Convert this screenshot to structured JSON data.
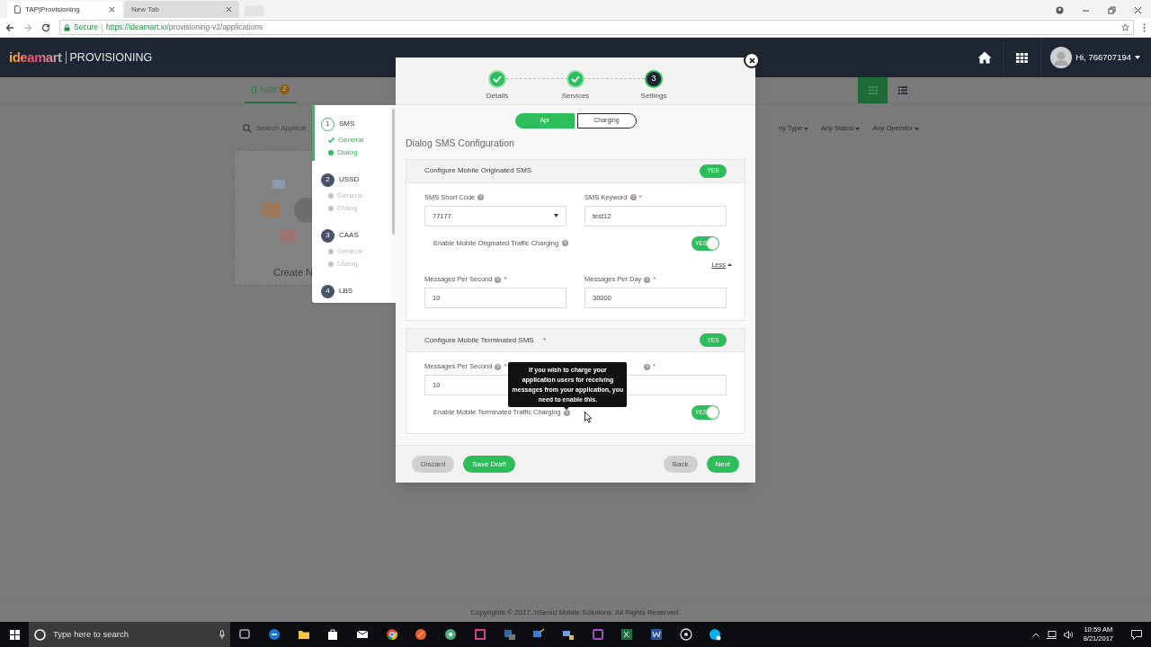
{
  "browser": {
    "tabs": [
      {
        "title": "TAP|Provisioning",
        "selected": true
      },
      {
        "title": "New Tab",
        "selected": false
      }
    ],
    "secure_label": "Secure",
    "url_host": "https://ideamart.io",
    "url_path": "/provisioning-v2/applications"
  },
  "header": {
    "logo": "ideamart",
    "product": "PROVISIONING",
    "user": "Hi, 766707194"
  },
  "page": {
    "apps_tab": {
      "label": "Apps",
      "count": "2"
    },
    "search_placeholder": "Search Applicat",
    "filters": [
      "ny Type",
      "Any Status",
      "Any Operator"
    ],
    "views": [
      {
        "kind": "grid",
        "selected": true
      },
      {
        "kind": "list",
        "selected": false
      }
    ],
    "card_label": "Create N",
    "footer": "Copyrights © 2017. hSenid Mobile Solutions. All Rights Reserved."
  },
  "service_steps": [
    {
      "number": "1",
      "label": "SMS",
      "selected": true,
      "items": [
        {
          "label": "General",
          "checked": true,
          "selected": false
        },
        {
          "label": "Dialog",
          "checked": false,
          "selected": true
        }
      ]
    },
    {
      "number": "2",
      "label": "USSD",
      "selected": false,
      "items": [
        {
          "label": "General",
          "checked": false,
          "selected": false
        },
        {
          "label": "Dialog",
          "checked": false,
          "selected": false
        }
      ]
    },
    {
      "number": "3",
      "label": "CAAS",
      "selected": false,
      "items": [
        {
          "label": "General",
          "checked": false,
          "selected": false
        },
        {
          "label": "Dialog",
          "checked": false,
          "selected": false
        }
      ]
    },
    {
      "number": "4",
      "label": "LBS",
      "selected": false
    }
  ],
  "wizard": {
    "steps": [
      {
        "label": "Details",
        "completed": true,
        "selected": false
      },
      {
        "label": "Services",
        "completed": true,
        "selected": false
      },
      {
        "number": "3",
        "label": "Settings",
        "completed": false,
        "selected": true
      }
    ],
    "tabs": [
      {
        "label": "Api",
        "selected": true
      },
      {
        "label": "Charging",
        "selected": false
      }
    ],
    "title": "Dialog SMS Configuration",
    "sections": [
      {
        "title": "Configure Mobile Originated SMS",
        "toggle": {
          "label": "YES",
          "on": true
        },
        "rows": [
          {
            "kind": "fields",
            "fields": [
              {
                "label": "SMS Short Code",
                "help": true,
                "kind": "select",
                "value": "77177"
              },
              {
                "label": "SMS Keyword",
                "help": true,
                "required_mark": "*",
                "kind": "text",
                "value": "test12"
              }
            ]
          },
          {
            "kind": "charging",
            "label": "Enable Mobile Originated Traffic Charging",
            "toggle": {
              "label": "YES",
              "on": true
            }
          },
          {
            "kind": "link",
            "label": "Less"
          },
          {
            "kind": "fields",
            "fields": [
              {
                "label": "Messages Per Second",
                "help": true,
                "required_mark": "*",
                "kind": "text",
                "value": "10"
              },
              {
                "label": "Messages Per Day",
                "help": true,
                "required_mark": "*",
                "kind": "text",
                "value": "30000"
              }
            ]
          }
        ]
      },
      {
        "title": "Configure Mobile Terminated SMS",
        "required_mark": "*",
        "toggle": {
          "label": "YES",
          "on": true
        },
        "rows": [
          {
            "kind": "fields",
            "fields": [
              {
                "label": "Messages Per Second",
                "help": true,
                "required_mark": "*",
                "kind": "text",
                "value": "10"
              },
              {
                "help": true,
                "required_mark": "*",
                "kind": "text"
              }
            ]
          },
          {
            "kind": "charging",
            "label": "Enable Mobile Terminated Traffic Charging",
            "toggle": {
              "label": "YES",
              "on": true
            },
            "tooltip": "If you wish to charge your application users for receiving messages from your application, you need to enable this."
          }
        ]
      }
    ],
    "buttons": [
      {
        "label": "Discard",
        "kind": "muted"
      },
      {
        "label": "Save Draft",
        "kind": "primary"
      },
      {
        "label": "Back",
        "kind": "muted"
      },
      {
        "label": "Next",
        "kind": "primary"
      }
    ]
  },
  "taskbar": {
    "search_placeholder": "Type here to search",
    "time": "10:59 AM",
    "date": "8/21/2017"
  }
}
